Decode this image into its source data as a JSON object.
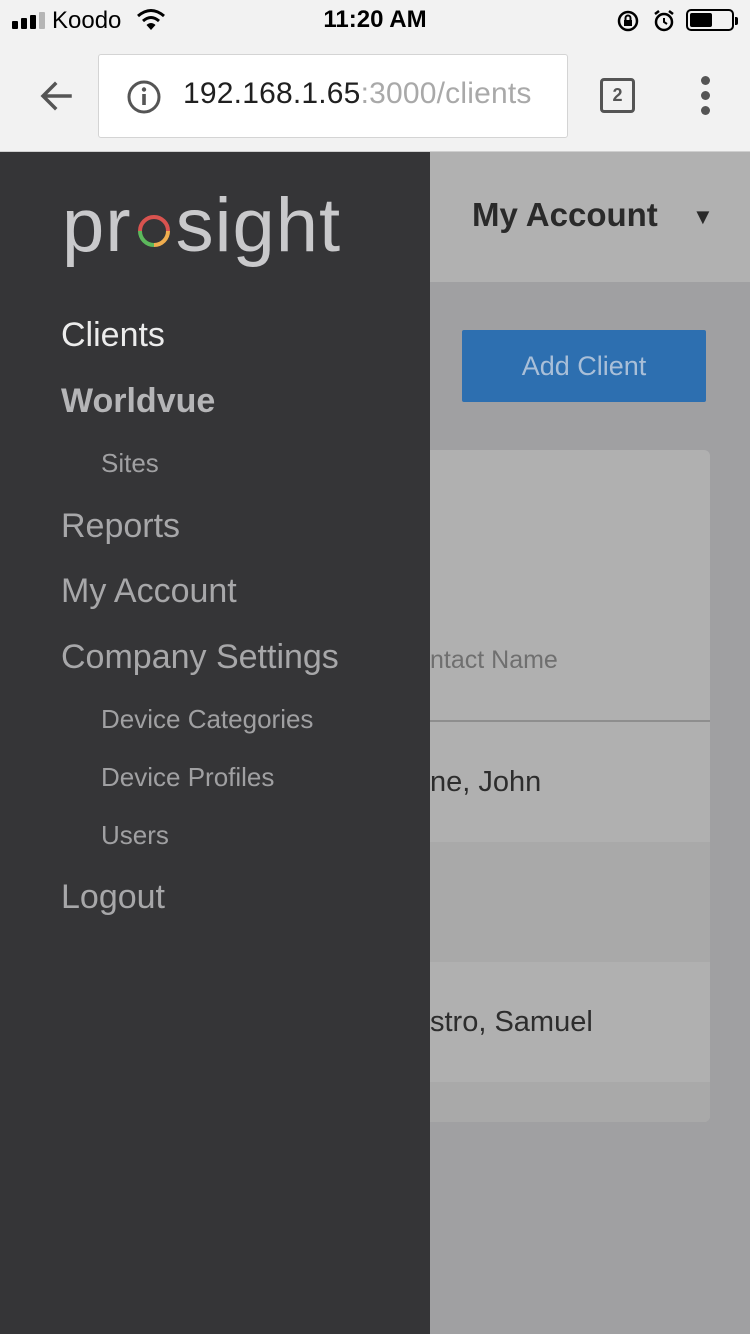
{
  "status_bar": {
    "carrier": "Koodo",
    "time": "11:20 AM"
  },
  "browser": {
    "url_host": "192.168.1.65",
    "url_path": ":3000/clients",
    "tab_count": "2"
  },
  "header": {
    "account_label": "My Account",
    "caret": "▼"
  },
  "main": {
    "add_client_label": "Add Client",
    "column_header": "ntact Name",
    "rows": [
      "ne, John",
      "",
      "stro, Samuel"
    ]
  },
  "drawer": {
    "logo_text": "prosight",
    "logo_colors": [
      "#d9534f",
      "#f0ad4e",
      "#5cb85c"
    ],
    "items": {
      "clients": "Clients",
      "worldvue": "Worldvue",
      "sites": "Sites",
      "reports": "Reports",
      "my_account": "My Account",
      "company_settings": "Company Settings",
      "device_categories": "Device Categories",
      "device_profiles": "Device Profiles",
      "users": "Users",
      "logout": "Logout"
    }
  }
}
